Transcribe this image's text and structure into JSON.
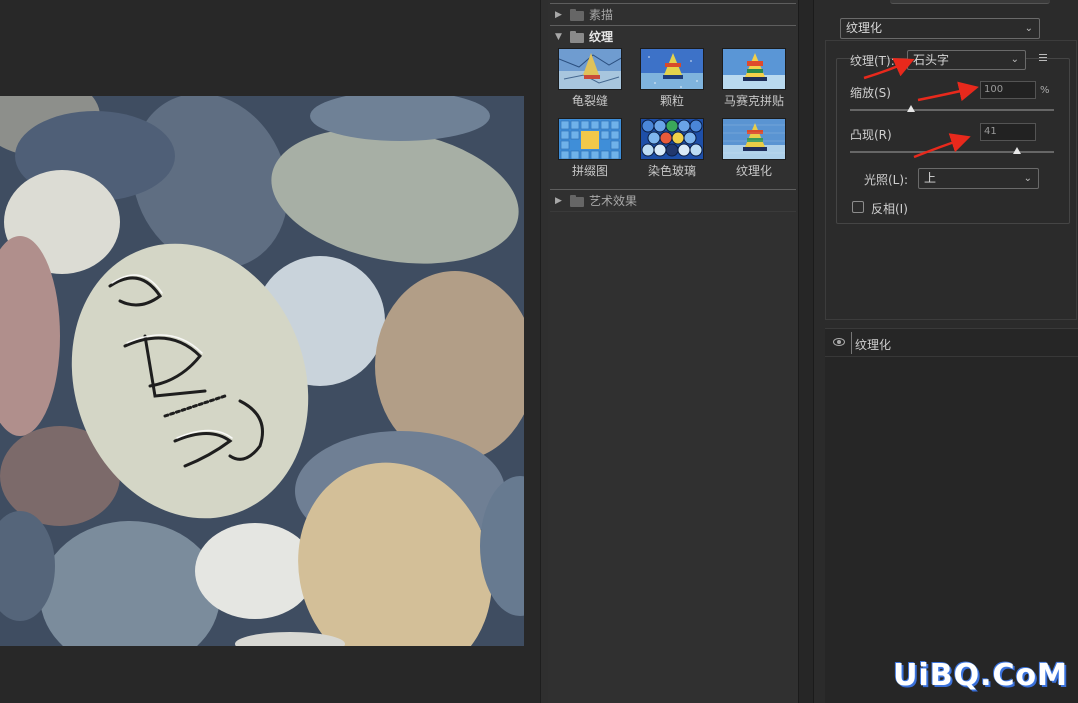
{
  "gallery": {
    "groups": [
      {
        "label": "素描",
        "expanded": false
      },
      {
        "label": "纹理",
        "expanded": true
      },
      {
        "label": "艺术效果",
        "expanded": false
      }
    ],
    "texture_filters": [
      {
        "label": "龟裂缝",
        "icon": "craquelure-thumbnail"
      },
      {
        "label": "颗粒",
        "icon": "grain-thumbnail"
      },
      {
        "label": "马赛克拼贴",
        "icon": "mosaic-tiles-thumbnail"
      },
      {
        "label": "拼缀图",
        "icon": "patchwork-thumbnail"
      },
      {
        "label": "染色玻璃",
        "icon": "stained-glass-thumbnail"
      },
      {
        "label": "纹理化",
        "icon": "texturizer-thumbnail"
      }
    ]
  },
  "settings": {
    "filter_select": "纹理化",
    "texture_label": "纹理(T):",
    "texture_value": "石头字",
    "scaling_label": "缩放(S)",
    "scaling_value": "100",
    "scaling_unit": "%",
    "scaling_fraction": 0.3,
    "relief_label": "凸现(R)",
    "relief_value": "41",
    "relief_fraction": 0.82,
    "light_label": "光照(L):",
    "light_value": "上",
    "invert_label": "反相(I)",
    "invert_checked": false
  },
  "layers": {
    "effect_name": "纹理化"
  },
  "watermark": "UiBQ.CoM",
  "colors": {
    "annotation_arrow": "#e8291c",
    "watermark_outline": "#3a6fd8"
  }
}
